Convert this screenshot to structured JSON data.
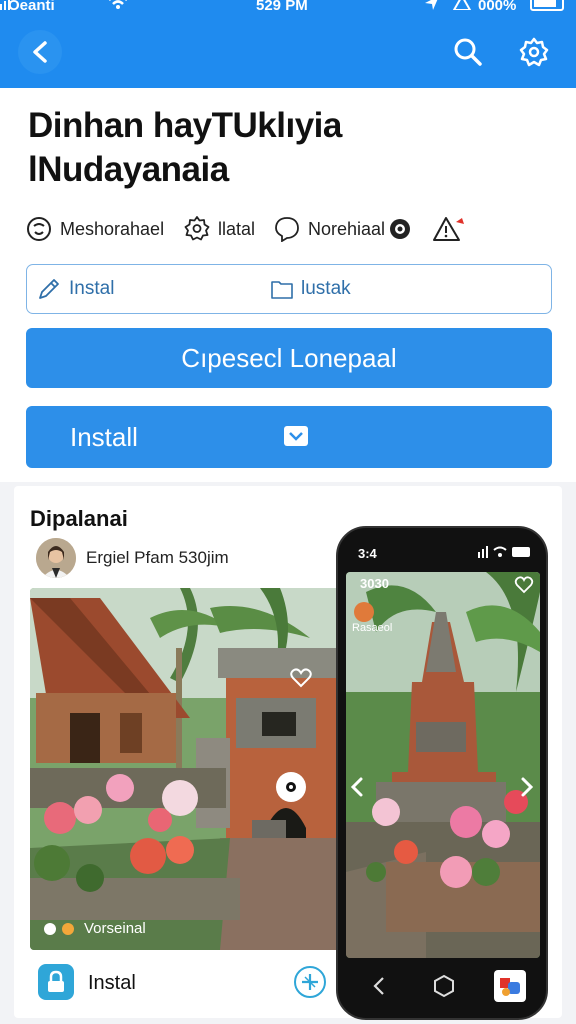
{
  "status_bar": {
    "carrier": "Oeanti",
    "time": "529 PM",
    "battery": "000%"
  },
  "header": {
    "title_line1": "Dinhan hayTUklıyia",
    "title_line2": "lNudayanaia"
  },
  "meta": {
    "item1": "Meshorahael",
    "item2": "llatal",
    "item3": "Norehiaal"
  },
  "field": {
    "left_label": "Instal",
    "right_label": "lustak"
  },
  "buttons": {
    "primary": "Cıpesecl Lonepaal",
    "install": "Install"
  },
  "post": {
    "title": "Dipalanai",
    "author": "Ergiel Pfam 530jim",
    "photo_caption": "Vorseinal",
    "install_link": "Instal"
  },
  "phone": {
    "status_time": "3:4",
    "screen_time": "3030",
    "screen_user": "Rasaeol"
  },
  "icons": {
    "back": "back-arrow-icon",
    "search": "search-icon",
    "settings": "gear-icon"
  },
  "colors": {
    "accent": "#1f8bef",
    "button": "#2d8fe9"
  }
}
